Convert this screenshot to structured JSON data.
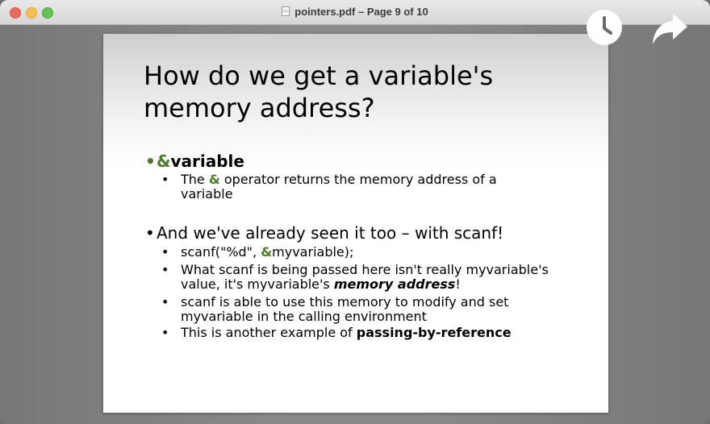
{
  "window": {
    "title": "pointers.pdf – Page 9 of 10"
  },
  "slide": {
    "title": "How do we get a variable's memory address?",
    "bullet1": {
      "green": "&",
      "text": "variable",
      "sub": {
        "pre": "The ",
        "green": "&",
        "post": " operator returns the memory address of a variable"
      }
    },
    "bullet2": {
      "text": "And we've already seen it too – with scanf!",
      "subs": {
        "s1_pre": "scanf(\"%d\", ",
        "s1_green": "&",
        "s1_post": "myvariable);",
        "s2_pre": "What scanf is being passed here isn't really myvariable's value, it's myvariable's ",
        "s2_emph": "memory address",
        "s2_post": "!",
        "s3": "scanf is able to use this memory to modify and set myvariable in the calling environment",
        "s4_pre": "This is another example of ",
        "s4_bold": "passing-by-reference"
      }
    }
  },
  "icons": [
    "clock-icon",
    "share-arrow-icon"
  ]
}
